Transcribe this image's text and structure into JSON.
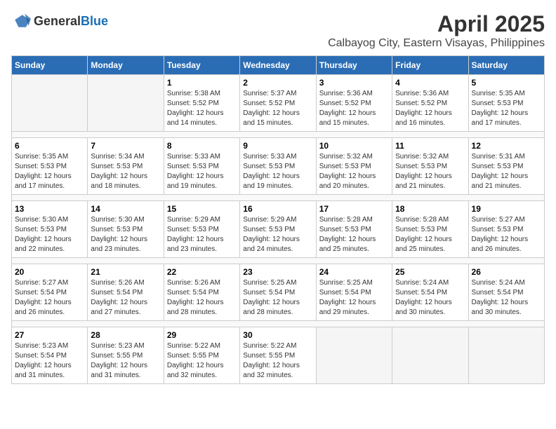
{
  "logo": {
    "general": "General",
    "blue": "Blue"
  },
  "title": "April 2025",
  "subtitle": "Calbayog City, Eastern Visayas, Philippines",
  "days_of_week": [
    "Sunday",
    "Monday",
    "Tuesday",
    "Wednesday",
    "Thursday",
    "Friday",
    "Saturday"
  ],
  "weeks": [
    [
      {
        "day": "",
        "info": ""
      },
      {
        "day": "",
        "info": ""
      },
      {
        "day": "1",
        "sunrise": "Sunrise: 5:38 AM",
        "sunset": "Sunset: 5:52 PM",
        "daylight": "Daylight: 12 hours and 14 minutes."
      },
      {
        "day": "2",
        "sunrise": "Sunrise: 5:37 AM",
        "sunset": "Sunset: 5:52 PM",
        "daylight": "Daylight: 12 hours and 15 minutes."
      },
      {
        "day": "3",
        "sunrise": "Sunrise: 5:36 AM",
        "sunset": "Sunset: 5:52 PM",
        "daylight": "Daylight: 12 hours and 15 minutes."
      },
      {
        "day": "4",
        "sunrise": "Sunrise: 5:36 AM",
        "sunset": "Sunset: 5:52 PM",
        "daylight": "Daylight: 12 hours and 16 minutes."
      },
      {
        "day": "5",
        "sunrise": "Sunrise: 5:35 AM",
        "sunset": "Sunset: 5:53 PM",
        "daylight": "Daylight: 12 hours and 17 minutes."
      }
    ],
    [
      {
        "day": "6",
        "sunrise": "Sunrise: 5:35 AM",
        "sunset": "Sunset: 5:53 PM",
        "daylight": "Daylight: 12 hours and 17 minutes."
      },
      {
        "day": "7",
        "sunrise": "Sunrise: 5:34 AM",
        "sunset": "Sunset: 5:53 PM",
        "daylight": "Daylight: 12 hours and 18 minutes."
      },
      {
        "day": "8",
        "sunrise": "Sunrise: 5:33 AM",
        "sunset": "Sunset: 5:53 PM",
        "daylight": "Daylight: 12 hours and 19 minutes."
      },
      {
        "day": "9",
        "sunrise": "Sunrise: 5:33 AM",
        "sunset": "Sunset: 5:53 PM",
        "daylight": "Daylight: 12 hours and 19 minutes."
      },
      {
        "day": "10",
        "sunrise": "Sunrise: 5:32 AM",
        "sunset": "Sunset: 5:53 PM",
        "daylight": "Daylight: 12 hours and 20 minutes."
      },
      {
        "day": "11",
        "sunrise": "Sunrise: 5:32 AM",
        "sunset": "Sunset: 5:53 PM",
        "daylight": "Daylight: 12 hours and 21 minutes."
      },
      {
        "day": "12",
        "sunrise": "Sunrise: 5:31 AM",
        "sunset": "Sunset: 5:53 PM",
        "daylight": "Daylight: 12 hours and 21 minutes."
      }
    ],
    [
      {
        "day": "13",
        "sunrise": "Sunrise: 5:30 AM",
        "sunset": "Sunset: 5:53 PM",
        "daylight": "Daylight: 12 hours and 22 minutes."
      },
      {
        "day": "14",
        "sunrise": "Sunrise: 5:30 AM",
        "sunset": "Sunset: 5:53 PM",
        "daylight": "Daylight: 12 hours and 23 minutes."
      },
      {
        "day": "15",
        "sunrise": "Sunrise: 5:29 AM",
        "sunset": "Sunset: 5:53 PM",
        "daylight": "Daylight: 12 hours and 23 minutes."
      },
      {
        "day": "16",
        "sunrise": "Sunrise: 5:29 AM",
        "sunset": "Sunset: 5:53 PM",
        "daylight": "Daylight: 12 hours and 24 minutes."
      },
      {
        "day": "17",
        "sunrise": "Sunrise: 5:28 AM",
        "sunset": "Sunset: 5:53 PM",
        "daylight": "Daylight: 12 hours and 25 minutes."
      },
      {
        "day": "18",
        "sunrise": "Sunrise: 5:28 AM",
        "sunset": "Sunset: 5:53 PM",
        "daylight": "Daylight: 12 hours and 25 minutes."
      },
      {
        "day": "19",
        "sunrise": "Sunrise: 5:27 AM",
        "sunset": "Sunset: 5:53 PM",
        "daylight": "Daylight: 12 hours and 26 minutes."
      }
    ],
    [
      {
        "day": "20",
        "sunrise": "Sunrise: 5:27 AM",
        "sunset": "Sunset: 5:54 PM",
        "daylight": "Daylight: 12 hours and 26 minutes."
      },
      {
        "day": "21",
        "sunrise": "Sunrise: 5:26 AM",
        "sunset": "Sunset: 5:54 PM",
        "daylight": "Daylight: 12 hours and 27 minutes."
      },
      {
        "day": "22",
        "sunrise": "Sunrise: 5:26 AM",
        "sunset": "Sunset: 5:54 PM",
        "daylight": "Daylight: 12 hours and 28 minutes."
      },
      {
        "day": "23",
        "sunrise": "Sunrise: 5:25 AM",
        "sunset": "Sunset: 5:54 PM",
        "daylight": "Daylight: 12 hours and 28 minutes."
      },
      {
        "day": "24",
        "sunrise": "Sunrise: 5:25 AM",
        "sunset": "Sunset: 5:54 PM",
        "daylight": "Daylight: 12 hours and 29 minutes."
      },
      {
        "day": "25",
        "sunrise": "Sunrise: 5:24 AM",
        "sunset": "Sunset: 5:54 PM",
        "daylight": "Daylight: 12 hours and 30 minutes."
      },
      {
        "day": "26",
        "sunrise": "Sunrise: 5:24 AM",
        "sunset": "Sunset: 5:54 PM",
        "daylight": "Daylight: 12 hours and 30 minutes."
      }
    ],
    [
      {
        "day": "27",
        "sunrise": "Sunrise: 5:23 AM",
        "sunset": "Sunset: 5:54 PM",
        "daylight": "Daylight: 12 hours and 31 minutes."
      },
      {
        "day": "28",
        "sunrise": "Sunrise: 5:23 AM",
        "sunset": "Sunset: 5:55 PM",
        "daylight": "Daylight: 12 hours and 31 minutes."
      },
      {
        "day": "29",
        "sunrise": "Sunrise: 5:22 AM",
        "sunset": "Sunset: 5:55 PM",
        "daylight": "Daylight: 12 hours and 32 minutes."
      },
      {
        "day": "30",
        "sunrise": "Sunrise: 5:22 AM",
        "sunset": "Sunset: 5:55 PM",
        "daylight": "Daylight: 12 hours and 32 minutes."
      },
      {
        "day": "",
        "info": ""
      },
      {
        "day": "",
        "info": ""
      },
      {
        "day": "",
        "info": ""
      }
    ]
  ]
}
